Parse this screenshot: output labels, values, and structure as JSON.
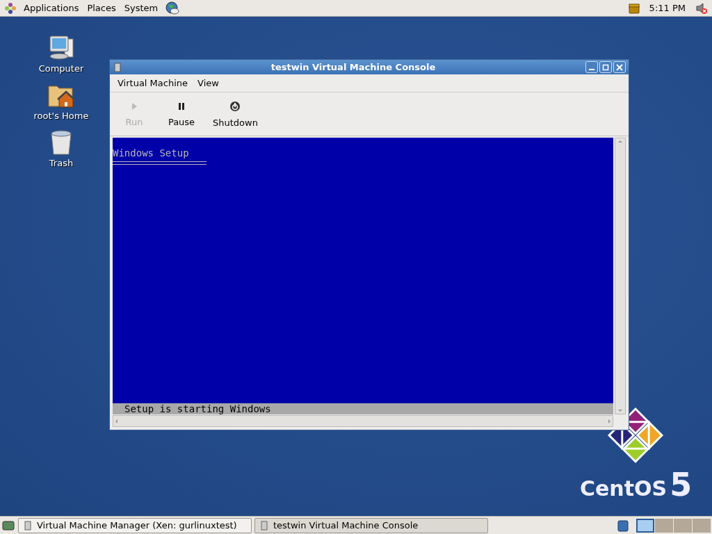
{
  "top_panel": {
    "menus": [
      "Applications",
      "Places",
      "System"
    ],
    "clock": "5:11 PM"
  },
  "desktop_icons": [
    {
      "kind": "computer",
      "label": "Computer"
    },
    {
      "kind": "home",
      "label": "root's Home"
    },
    {
      "kind": "trash",
      "label": "Trash"
    }
  ],
  "window": {
    "title": "testwin Virtual Machine Console",
    "menus": [
      "Virtual Machine",
      "View"
    ],
    "toolbar": [
      {
        "kind": "run",
        "label": "Run",
        "disabled": true
      },
      {
        "kind": "pause",
        "label": "Pause",
        "disabled": false
      },
      {
        "kind": "shutdown",
        "label": "Shutdown",
        "disabled": false
      }
    ],
    "console": {
      "heading": "Windows Setup",
      "status": "Setup is starting Windows"
    }
  },
  "logo": {
    "name": "CentOS",
    "version": "5"
  },
  "taskbar": {
    "tasks": [
      {
        "label": "Virtual Machine Manager (Xen: gurlinuxtest)",
        "selected": false
      },
      {
        "label": "testwin Virtual Machine Console",
        "selected": true
      }
    ],
    "workspaces": [
      {
        "selected": true
      },
      {
        "selected": false
      },
      {
        "selected": false
      },
      {
        "selected": false
      }
    ]
  }
}
